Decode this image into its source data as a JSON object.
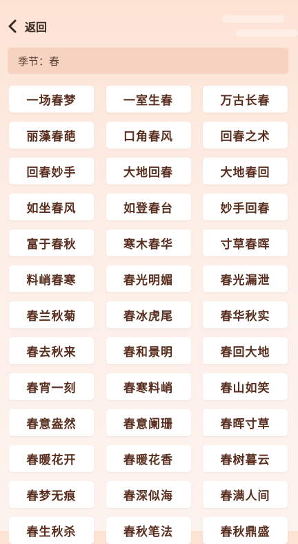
{
  "header": {
    "back_label": "返回"
  },
  "season": {
    "label": "季节：",
    "value": "春"
  },
  "idioms": [
    "一场春梦",
    "一室生春",
    "万古长春",
    "丽藻春葩",
    "口角春风",
    "回春之术",
    "回春妙手",
    "大地回春",
    "大地春回",
    "如坐春风",
    "如登春台",
    "妙手回春",
    "富于春秋",
    "寒木春华",
    "寸草春晖",
    "料峭春寒",
    "春光明媚",
    "春光漏泄",
    "春兰秋菊",
    "春冰虎尾",
    "春华秋实",
    "春去秋来",
    "春和景明",
    "春回大地",
    "春宵一刻",
    "春寒料峭",
    "春山如笑",
    "春意盎然",
    "春意阑珊",
    "春晖寸草",
    "春暖花开",
    "春暖花香",
    "春树暮云",
    "春梦无痕",
    "春深似海",
    "春满人间",
    "春生秋杀",
    "春秋笔法",
    "春秋鼎盛"
  ],
  "colors": {
    "accent_bar": "#f6d2c0",
    "idiom_text": "#5a2e1e",
    "background_top": "#fde3d4"
  }
}
